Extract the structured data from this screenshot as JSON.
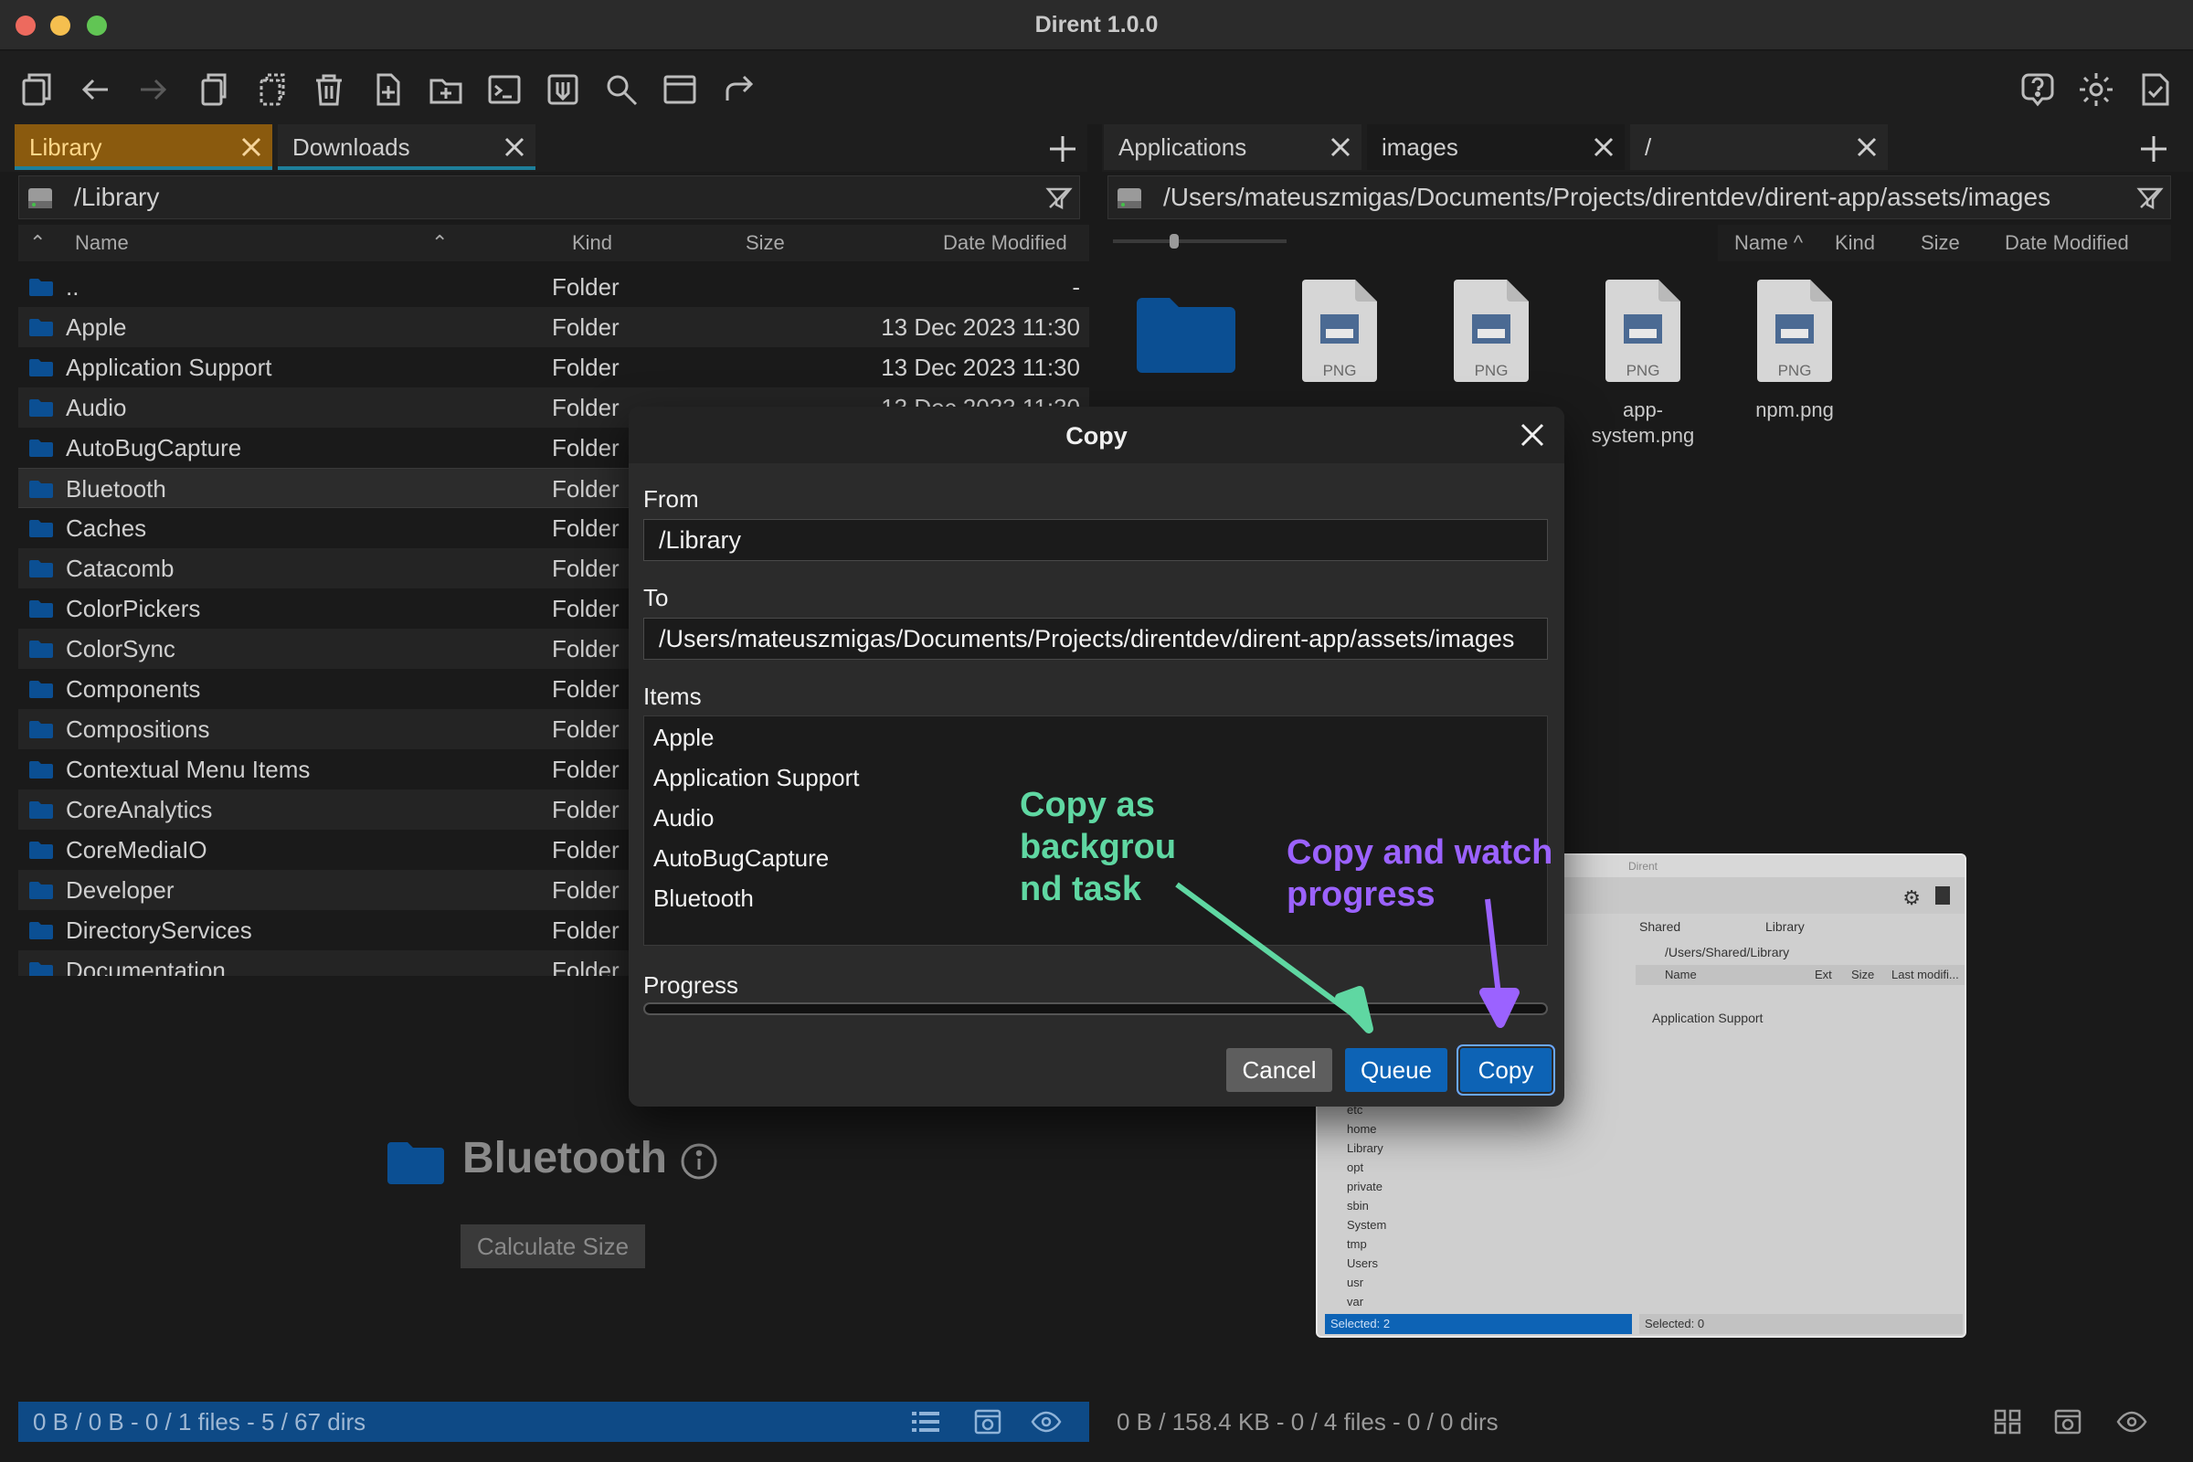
{
  "window": {
    "title": "Dirent 1.0.0"
  },
  "left_pane": {
    "tabs": [
      {
        "label": "Library"
      },
      {
        "label": "Downloads"
      }
    ],
    "path": "/Library",
    "columns": {
      "name": "Name",
      "kind": "Kind",
      "size": "Size",
      "date": "Date Modified"
    },
    "rows": [
      {
        "name": "..",
        "kind": "Folder",
        "date": "-"
      },
      {
        "name": "Apple",
        "kind": "Folder",
        "date": "13 Dec 2023 11:30"
      },
      {
        "name": "Application Support",
        "kind": "Folder",
        "date": "13 Dec 2023 11:30"
      },
      {
        "name": "Audio",
        "kind": "Folder",
        "date": "13 Dec 2023 11:30"
      },
      {
        "name": "AutoBugCapture",
        "kind": "Folder",
        "date": ""
      },
      {
        "name": "Bluetooth",
        "kind": "Folder",
        "date": ""
      },
      {
        "name": "Caches",
        "kind": "Folder",
        "date": ""
      },
      {
        "name": "Catacomb",
        "kind": "Folder",
        "date": ""
      },
      {
        "name": "ColorPickers",
        "kind": "Folder",
        "date": ""
      },
      {
        "name": "ColorSync",
        "kind": "Folder",
        "date": ""
      },
      {
        "name": "Components",
        "kind": "Folder",
        "date": ""
      },
      {
        "name": "Compositions",
        "kind": "Folder",
        "date": ""
      },
      {
        "name": "Contextual Menu Items",
        "kind": "Folder",
        "date": ""
      },
      {
        "name": "CoreAnalytics",
        "kind": "Folder",
        "date": ""
      },
      {
        "name": "CoreMediaIO",
        "kind": "Folder",
        "date": ""
      },
      {
        "name": "Developer",
        "kind": "Folder",
        "date": ""
      },
      {
        "name": "DirectoryServices",
        "kind": "Folder",
        "date": ""
      },
      {
        "name": "Documentation",
        "kind": "Folder",
        "date": ""
      }
    ],
    "preview": {
      "title": "Bluetooth",
      "button": "Calculate Size"
    },
    "status": "0 B / 0 B - 0 / 1 files - 5 / 67 dirs"
  },
  "right_pane": {
    "tabs": [
      {
        "label": "Applications"
      },
      {
        "label": "images"
      },
      {
        "label": "/"
      }
    ],
    "path": "/Users/mateuszmigas/Documents/Projects/direntdev/dirent-app/assets/images",
    "columns": {
      "name": "Name ^",
      "kind": "Kind",
      "size": "Size",
      "date": "Date Modified"
    },
    "items": [
      {
        "name": ""
      },
      {
        "badge": "PNG",
        "name": ""
      },
      {
        "badge": "PNG",
        "name": ""
      },
      {
        "badge": "PNG",
        "name": "app-\nsystem.png"
      },
      {
        "badge": "PNG",
        "name": "npm.png"
      }
    ],
    "status": "0 B / 158.4 KB - 0 / 4 files - 0 / 0 dirs"
  },
  "embedded_screenshot": {
    "title": "Dirent",
    "tabs": [
      "Shared",
      "Library"
    ],
    "path": "/Users/Shared/Library",
    "head": [
      "Name",
      "Ext",
      "Size",
      "Last modifi..."
    ],
    "right_rows": [
      "Application Support"
    ],
    "left_rows": [
      "etc",
      "home",
      "Library",
      "opt",
      "private",
      "sbin",
      "System",
      "tmp",
      "Users",
      "usr",
      "var"
    ],
    "status_left": "Selected: 2",
    "status_right": "Selected: 0"
  },
  "dialog": {
    "title": "Copy",
    "from_label": "From",
    "from_value": "/Library",
    "to_label": "To",
    "to_value": "/Users/mateuszmigas/Documents/Projects/direntdev/dirent-app/assets/images",
    "items_label": "Items",
    "items": [
      "Apple",
      "Application Support",
      "Audio",
      "AutoBugCapture",
      "Bluetooth"
    ],
    "progress_label": "Progress",
    "progress": 0,
    "buttons": {
      "cancel": "Cancel",
      "queue": "Queue",
      "copy": "Copy"
    }
  },
  "annotations": {
    "queue_note": "Copy as backgrou nd task",
    "copy_note": "Copy and watch progress"
  },
  "colors": {
    "accent_blue": "#0d63b5",
    "active_tab": "#8a5a0e",
    "folder": "#0b4f93",
    "annotation_green": "#5fd7a2",
    "annotation_purple": "#9b62ff"
  }
}
